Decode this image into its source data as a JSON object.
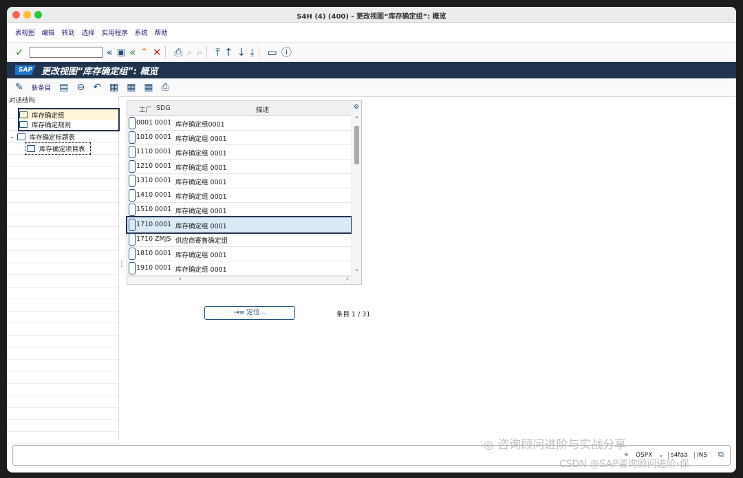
{
  "window": {
    "title": "S4H (4) (400) - 更改视图“库存确定组”: 概览",
    "colors": {
      "close": "#fe5f57",
      "min": "#febc2e",
      "max": "#28c840"
    }
  },
  "menu": [
    "表视图",
    "编辑",
    "转到",
    "选择",
    "实用程序",
    "系统",
    "帮助"
  ],
  "toolbar": {
    "icons": [
      "check-icon",
      "command-field",
      "back-arrows-icon",
      "save-icon",
      "back-icon",
      "exit-icon",
      "cancel-icon",
      "print-icon",
      "find-icon",
      "find-next-icon",
      "first-page-icon",
      "prev-page-icon",
      "next-page-icon",
      "last-page-icon",
      "new-session-icon",
      "help-icon"
    ]
  },
  "sap": {
    "logo": "SAP",
    "title": "更改视图“库存确定组”: 概览"
  },
  "apptoolbar": {
    "new_entries": "新条目"
  },
  "tree": {
    "header": "对话结构",
    "items": [
      "库存确定组",
      "库存确定规则",
      "库存确定标题表",
      "库存确定项目表"
    ]
  },
  "grid": {
    "columns": [
      "工厂",
      "SDG",
      "描述"
    ],
    "rows": [
      [
        "0001",
        "0001",
        "库存确定组0001"
      ],
      [
        "1010",
        "0001",
        "库存确定组 0001"
      ],
      [
        "1110",
        "0001",
        "库存确定组 0001"
      ],
      [
        "1210",
        "0001",
        "库存确定组 0001"
      ],
      [
        "1310",
        "0001",
        "库存确定组 0001"
      ],
      [
        "1410",
        "0001",
        "库存确定组 0001"
      ],
      [
        "1510",
        "0001",
        "库存确定组 0001"
      ],
      [
        "1710",
        "0001",
        "库存确定组 0001"
      ],
      [
        "1710",
        "ZMJS",
        "供应商寄售确定组"
      ],
      [
        "1810",
        "0001",
        "库存确定组 0001"
      ],
      [
        "1910",
        "0001",
        "库存确定组 0001"
      ]
    ],
    "selected_row": 7
  },
  "position_button": "定位...",
  "entries": "条目 1 / 31",
  "status": {
    "system": "OSPX",
    "server": "s4faa",
    "mode": "INS"
  },
  "watermark": {
    "line1": "咨询顾问进阶与实战分享",
    "line2": "CSDN @SAP咨询顾问进阶-保"
  }
}
